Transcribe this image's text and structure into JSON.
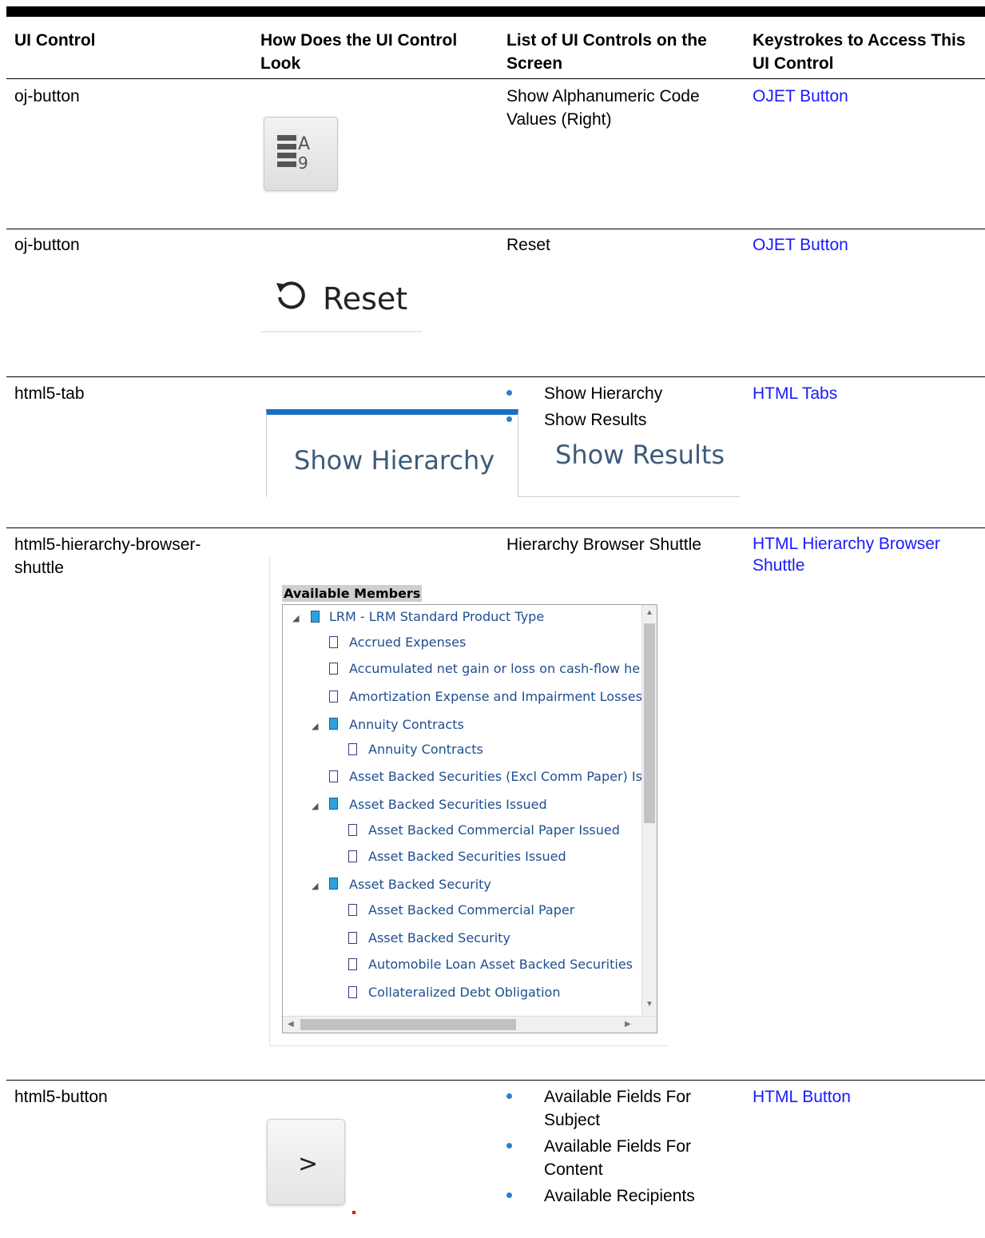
{
  "headers": {
    "col1": "UI Control",
    "col2": "How Does the UI Control Look",
    "col3": "List of UI Controls on the Screen",
    "col4": "Keystrokes to Access This UI Control"
  },
  "rows": [
    {
      "control": "oj-button",
      "screen_list": "Show Alphanumeric Code Values (Right)",
      "access_link": "OJET Button"
    },
    {
      "control": "oj-button",
      "screen_list": "Reset",
      "access_link": "OJET Button",
      "visual_label": "Reset"
    },
    {
      "control": "html5-tab",
      "screen_items": [
        "Show Hierarchy",
        "Show Results"
      ],
      "access_link": "HTML Tabs",
      "tabs": [
        "Show Hierarchy",
        "Show Results"
      ]
    },
    {
      "control": "html5-hierarchy-browser-shuttle",
      "screen_list": "Hierarchy Browser Shuttle",
      "access_link": "HTML Hierarchy Browser Shuttle"
    },
    {
      "control": "html5-button",
      "screen_items": [
        "Available Fields For Subject",
        "Available Fields For Content",
        "Available Recipients"
      ],
      "access_link": "HTML Button",
      "visual_label": ">"
    }
  ],
  "shuttle": {
    "label": "Available Members",
    "items": [
      "LRM - LRM Standard Product Type",
      "Accrued Expenses",
      "Accumulated net gain or loss on cash-flow he",
      "Amortization Expense and Impairment Losses",
      "Annuity Contracts",
      "Annuity Contracts",
      "Asset Backed Securities (Excl Comm Paper) Iss",
      "Asset Backed Securities Issued",
      "Asset Backed Commercial Paper Issued",
      "Asset Backed Securities Issued",
      "Asset Backed Security",
      "Asset Backed Commercial Paper",
      "Asset Backed Security",
      "Automobile Loan Asset Backed Securities",
      "Collateralized Debt Obligation"
    ]
  },
  "colors": {
    "link": "#1a1aff",
    "bullet": "#2e7ec9",
    "tab_accent": "#1b6ec2"
  }
}
